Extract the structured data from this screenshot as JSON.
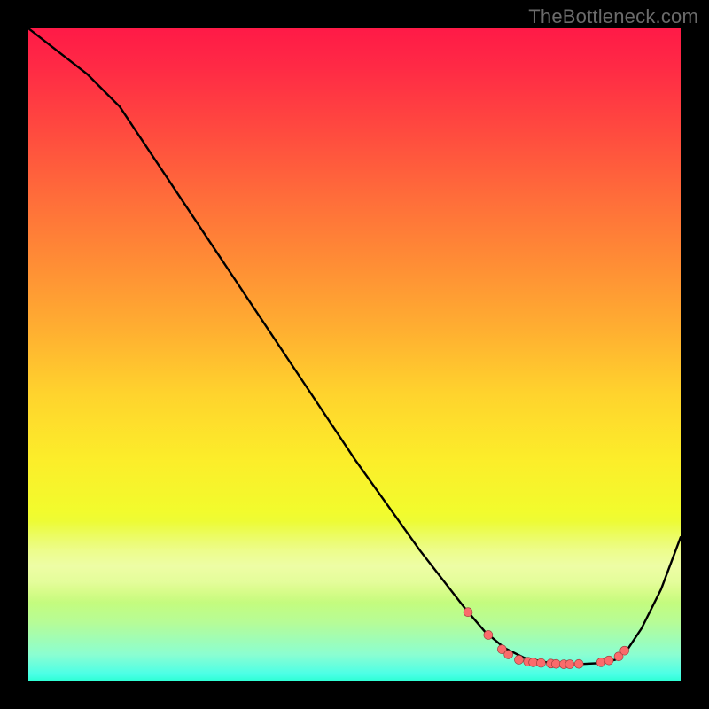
{
  "watermark": "TheBottleneck.com",
  "colors": {
    "curve": "#000000",
    "marker_fill": "#fa6b6b",
    "marker_stroke": "#9a3a3a",
    "background_black": "#000000"
  },
  "chart_data": {
    "type": "line",
    "title": "",
    "xlabel": "",
    "ylabel": "",
    "xlim": [
      0,
      100
    ],
    "ylim": [
      0,
      100
    ],
    "note": "No axis ticks or numeric labels are visible in the image; x/y values below are pixel-position estimates on a 0–100 normalized scale (origin top-left of plot area).",
    "series": [
      {
        "name": "curve",
        "x": [
          0,
          9,
          14,
          20,
          30,
          40,
          50,
          60,
          67,
          70,
          73,
          76,
          80,
          84,
          88,
          90,
          92,
          94,
          97,
          100
        ],
        "values": [
          0,
          7,
          12,
          21,
          36,
          51,
          66,
          80,
          89,
          92.5,
          95,
          96.5,
          97.3,
          97.5,
          97.3,
          96.8,
          95,
          92,
          86,
          78
        ]
      }
    ],
    "markers": {
      "name": "highlighted-points",
      "x": [
        67.4,
        70.5,
        72.6,
        73.6,
        75.2,
        76.6,
        77.4,
        78.6,
        80.1,
        80.9,
        82.1,
        83.0,
        84.4,
        87.8,
        89.0,
        90.5,
        91.4
      ],
      "values": [
        89.5,
        93.0,
        95.2,
        96.0,
        96.8,
        97.1,
        97.2,
        97.3,
        97.4,
        97.45,
        97.5,
        97.5,
        97.45,
        97.2,
        96.9,
        96.3,
        95.4
      ]
    }
  }
}
